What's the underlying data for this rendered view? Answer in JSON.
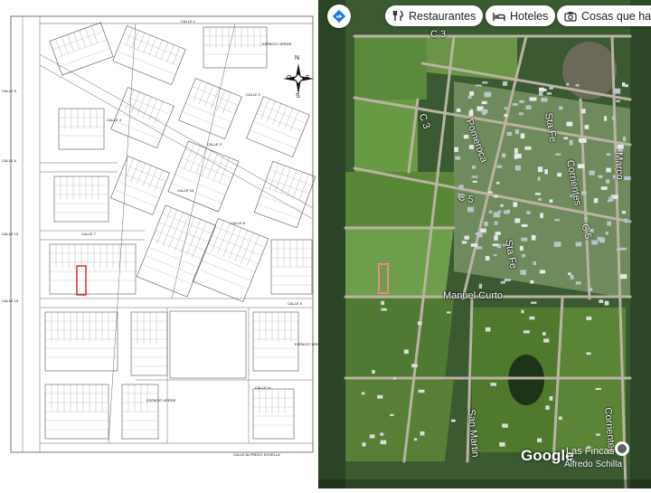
{
  "plan": {
    "street_labels": [
      "CALLE 1",
      "CALLE 2",
      "CALLE 3",
      "CALLE 4",
      "CALLE 5",
      "CALLE 6",
      "CALLE 7",
      "CALLE 8",
      "CALLE 9",
      "CALLE 10",
      "CALLE 11",
      "CALLE 12",
      "CALLE 13"
    ],
    "green_space_labels": [
      "ESPACIO VERDE",
      "ESPACIO VERDE",
      "ESPACIO VERDE"
    ],
    "bottom_street": "CALLE ALFREDO SCHELLA",
    "compass": {
      "n": "N",
      "s": "S",
      "e": "E",
      "o": "O"
    },
    "highlight_color": "#d62020"
  },
  "map": {
    "chips": [
      {
        "label": "Restaurantes",
        "icon": "restaurant-icon"
      },
      {
        "label": "Hoteles",
        "icon": "hotel-icon"
      },
      {
        "label": "Cosas que ha",
        "icon": "camera-icon"
      }
    ],
    "streets": [
      "C 3",
      "C 3",
      "Pomeroca",
      "Sta Fe",
      "Corrientes",
      "Marco",
      "C 5",
      "C 5",
      "Sta Fe",
      "Manuel Curto",
      "San Martin",
      "Corrientes"
    ],
    "logo": "Google",
    "place": "Las Fincas",
    "place_street": "Alfredo Schilla",
    "highlight_color": "#e53935"
  }
}
